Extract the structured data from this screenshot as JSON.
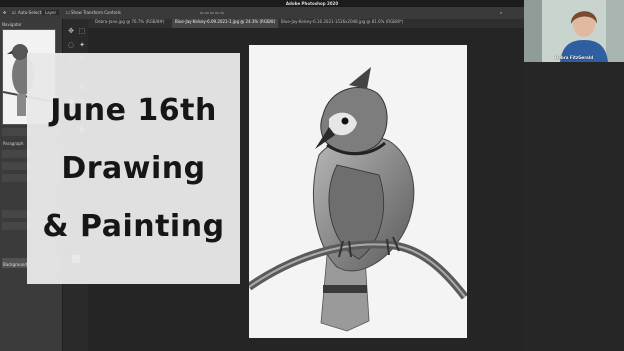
{
  "app": {
    "title": "Adobe Photoshop 2020"
  },
  "options_bar": {
    "auto_select_label": "Auto-Select:",
    "layer_select": "Layer",
    "transform_label": "Show Transform Controls"
  },
  "tabs": [
    {
      "label": "Debra-Jane.jpg @ 76.7% (RGB/8#)"
    },
    {
      "label": "Blue-Jay-Kelsey-6.09.2021-1.jpg @ 24.3% (RGB/8)"
    },
    {
      "label": "Blue-Jay-Kelsey-6.16.2021-1536x2048.jpg @ 81.6% (RGB/8*)"
    }
  ],
  "panels": {
    "navigator_label": "Navigator",
    "paragraph_label": "Paragraph",
    "background_label": "Background"
  },
  "title_card": {
    "line1": "June 16th",
    "line2": "Drawing",
    "line3": "& Painting"
  },
  "webcam": {
    "name": "Debra FitzGerald"
  },
  "colors": {
    "ui_dark": "#2b2b2b",
    "card": "#e8e8e8",
    "paper": "#f4f4f4"
  }
}
